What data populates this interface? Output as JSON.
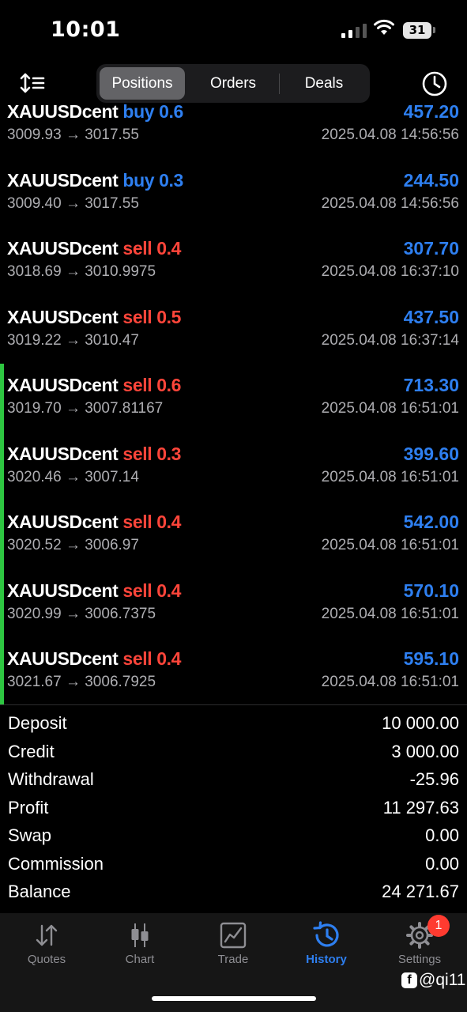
{
  "status_bar": {
    "time": "10:01",
    "battery": "31"
  },
  "toolbar": {
    "tabs": [
      {
        "label": "Positions"
      },
      {
        "label": "Orders"
      },
      {
        "label": "Deals"
      }
    ],
    "active_tab": "Positions",
    "sort_icon": "sort-icon",
    "history_icon": "clock-icon"
  },
  "colors": {
    "buy": "#2e7ff0",
    "sell": "#ff453a",
    "profit": "#2e7ff0",
    "accent_bar": "#2ec641",
    "active_tab": "#2e7ff0"
  },
  "deals": [
    {
      "symbol": "XAUUSDcent",
      "side": "buy",
      "volume": "0.6",
      "profit": "457.20",
      "prices": "3009.93 → 3017.55",
      "datetime": "2025.04.08 14:56:56"
    },
    {
      "symbol": "XAUUSDcent",
      "side": "buy",
      "volume": "0.3",
      "profit": "244.50",
      "prices": "3009.40 → 3017.55",
      "datetime": "2025.04.08 14:56:56"
    },
    {
      "symbol": "XAUUSDcent",
      "side": "sell",
      "volume": "0.4",
      "profit": "307.70",
      "prices": "3018.69 → 3010.9975",
      "datetime": "2025.04.08 16:37:10"
    },
    {
      "symbol": "XAUUSDcent",
      "side": "sell",
      "volume": "0.5",
      "profit": "437.50",
      "prices": "3019.22 → 3010.47",
      "datetime": "2025.04.08 16:37:14"
    },
    {
      "symbol": "XAUUSDcent",
      "side": "sell",
      "volume": "0.6",
      "profit": "713.30",
      "prices": "3019.70 → 3007.81167",
      "datetime": "2025.04.08 16:51:01"
    },
    {
      "symbol": "XAUUSDcent",
      "side": "sell",
      "volume": "0.3",
      "profit": "399.60",
      "prices": "3020.46 → 3007.14",
      "datetime": "2025.04.08 16:51:01"
    },
    {
      "symbol": "XAUUSDcent",
      "side": "sell",
      "volume": "0.4",
      "profit": "542.00",
      "prices": "3020.52 → 3006.97",
      "datetime": "2025.04.08 16:51:01"
    },
    {
      "symbol": "XAUUSDcent",
      "side": "sell",
      "volume": "0.4",
      "profit": "570.10",
      "prices": "3020.99 → 3006.7375",
      "datetime": "2025.04.08 16:51:01"
    },
    {
      "symbol": "XAUUSDcent",
      "side": "sell",
      "volume": "0.4",
      "profit": "595.10",
      "prices": "3021.67 → 3006.7925",
      "datetime": "2025.04.08 16:51:01"
    }
  ],
  "summary": [
    {
      "label": "Deposit",
      "value": "10 000.00"
    },
    {
      "label": "Credit",
      "value": "3 000.00"
    },
    {
      "label": "Withdrawal",
      "value": "-25.96"
    },
    {
      "label": "Profit",
      "value": "11 297.63"
    },
    {
      "label": "Swap",
      "value": "0.00"
    },
    {
      "label": "Commission",
      "value": "0.00"
    },
    {
      "label": "Balance",
      "value": "24 271.67"
    }
  ],
  "tabbar": {
    "items": [
      {
        "label": "Quotes",
        "icon": "quotes-arrows-icon"
      },
      {
        "label": "Chart",
        "icon": "candlestick-icon"
      },
      {
        "label": "Trade",
        "icon": "trade-chart-icon"
      },
      {
        "label": "History",
        "icon": "history-clock-icon"
      },
      {
        "label": "Settings",
        "icon": "gear-icon"
      }
    ],
    "active": "History",
    "settings_badge": "1"
  },
  "watermark": {
    "icon": "facebook-icon",
    "text": "@qi11"
  }
}
